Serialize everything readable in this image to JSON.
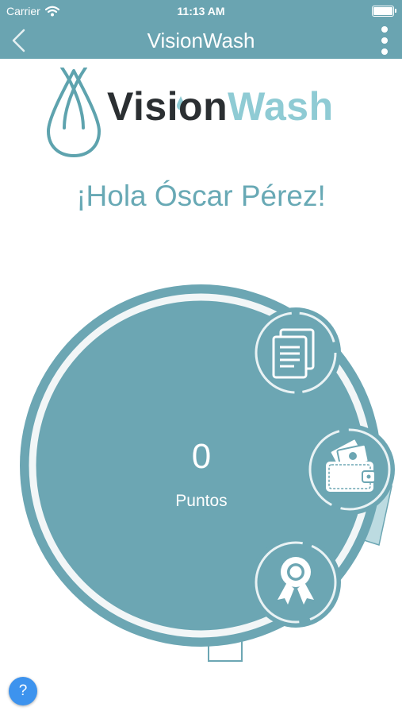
{
  "status_bar": {
    "carrier": "Carrier",
    "time": "11:13 AM"
  },
  "nav": {
    "title": "VisionWash"
  },
  "logo": {
    "part1": "Vision",
    "part2": "Wash"
  },
  "greeting": "¡Hola Óscar Pérez!",
  "points": {
    "value": "0",
    "label": "Puntos"
  },
  "help": {
    "label": "?"
  },
  "colors": {
    "primary": "#6aa4b1",
    "dial": "#6ca6b3",
    "logo_dark": "#2b2f32",
    "logo_light": "#8fcbd4",
    "help": "#3d93ee"
  },
  "icons": {
    "documents": "documents-icon",
    "wallet": "wallet-icon",
    "award": "award-ribbon-icon"
  }
}
